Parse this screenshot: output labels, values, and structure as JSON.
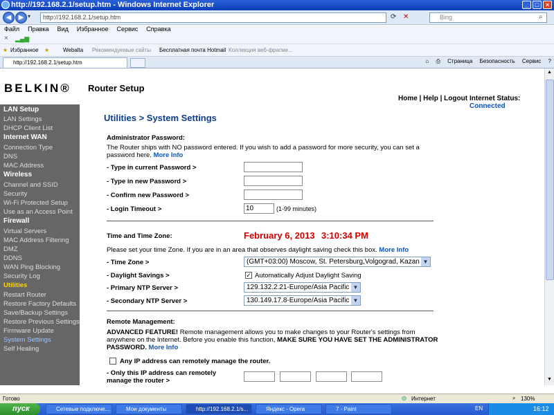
{
  "window": {
    "title": "http://192.168.2.1/setup.htm - Windows Internet Explorer"
  },
  "addressbar": {
    "url": "http://192.168.2.1/setup.htm",
    "search_placeholder": "Bing"
  },
  "menu": [
    "Файл",
    "Правка",
    "Вид",
    "Избранное",
    "Сервис",
    "Справка"
  ],
  "favorites": {
    "label": "Избранное",
    "items": [
      "Webalta",
      "Рекомендуемые сайты",
      "Бесплатная почта Hotmail",
      "Коллекция веб-фрагме..."
    ]
  },
  "tab": {
    "title": "http://192.168.2.1/setup.htm"
  },
  "commandbar": [
    "Страница",
    "Безопасность",
    "Сервис"
  ],
  "header": {
    "logo": "BELKIN®",
    "title": "Router Setup",
    "links": "Home | Help | Logout",
    "status_label": "Internet Status:",
    "status_value": "Connected"
  },
  "sidebar": [
    {
      "label": "LAN Setup",
      "type": "h"
    },
    {
      "label": "LAN Settings"
    },
    {
      "label": "DHCP Client List"
    },
    {
      "label": "Internet WAN",
      "type": "h"
    },
    {
      "label": "Connection Type"
    },
    {
      "label": "DNS"
    },
    {
      "label": "MAC Address"
    },
    {
      "label": "Wireless",
      "type": "h"
    },
    {
      "label": "Channel and SSID"
    },
    {
      "label": "Security"
    },
    {
      "label": "Wi-Fi Protected Setup"
    },
    {
      "label": "Use as an Access Point"
    },
    {
      "label": "Firewall",
      "type": "h"
    },
    {
      "label": "Virtual Servers"
    },
    {
      "label": "MAC Address Filtering"
    },
    {
      "label": "DMZ"
    },
    {
      "label": "DDNS"
    },
    {
      "label": "WAN Ping Blocking"
    },
    {
      "label": "Security Log"
    },
    {
      "label": "Utilities",
      "type": "cur"
    },
    {
      "label": "Restart Router"
    },
    {
      "label": "Restore Factory Defaults"
    },
    {
      "label": "Save/Backup Settings"
    },
    {
      "label": "Restore Previous Settings"
    },
    {
      "label": "Firmware Update"
    },
    {
      "label": "System Settings",
      "type": "act"
    },
    {
      "label": "Self Healing"
    }
  ],
  "content": {
    "title": "Utilities > System Settings",
    "admin": {
      "heading": "Administrator Password:",
      "desc1": "The Router ships with NO password entered. If you wish to add a password for more security, you can set a",
      "desc2": "password here.",
      "more": "More Info",
      "current_label": "- Type in current Password >",
      "new_label": "- Type in new Password >",
      "confirm_label": "- Confirm new Password >",
      "timeout_label": "- Login Timeout >",
      "timeout_value": "10",
      "timeout_hint": "(1-99 minutes)"
    },
    "time": {
      "heading": "Time and Time Zone:",
      "date": "February 6, 2013",
      "clock": "3:10:34 PM",
      "desc": "Please set your time Zone. If you are in an area that observes daylight saving check this box.",
      "more": "More Info",
      "zone_label": "- Time Zone >",
      "zone_value": "(GMT+03:00) Moscow, St. Petersburg,Volgograd, Kazan",
      "dst_label": "- Daylight Savings >",
      "dst_text": "Automatically Adjust Daylight Saving",
      "ntp1_label": "- Primary NTP Server >",
      "ntp1_value": "129.132.2.21-Europe/Asia Pacific",
      "ntp2_label": "- Secondary NTP Server >",
      "ntp2_value": "130.149.17.8-Europe/Asia Pacific"
    },
    "remote": {
      "heading": "Remote Management:",
      "adv": "ADVANCED FEATURE!",
      "desc1": " Remote management allows you to make changes to your Router's settings from",
      "desc2": "anywhere on the Internet. Before you enable this function,",
      "warn1": " MAKE SURE YOU HAVE SET THE ADMINISTRATOR",
      "warn2": "PASSWORD.",
      "more": "More Info",
      "any_ip": "Any IP address can remotely manage the router.",
      "only_ip1": "- Only this IP address can remotely",
      "only_ip2": "manage the router >"
    }
  },
  "statusbar": {
    "left": "Готово",
    "zone": "Интернет",
    "zoom": "130%"
  },
  "taskbar": {
    "start": "пуск",
    "items": [
      "Сетевые подключе...",
      "Мои документы",
      "http://192.168.2.1/s...",
      "Яндекс - Opera",
      "7 - Paint"
    ],
    "lang": "EN",
    "time": "16:12"
  }
}
